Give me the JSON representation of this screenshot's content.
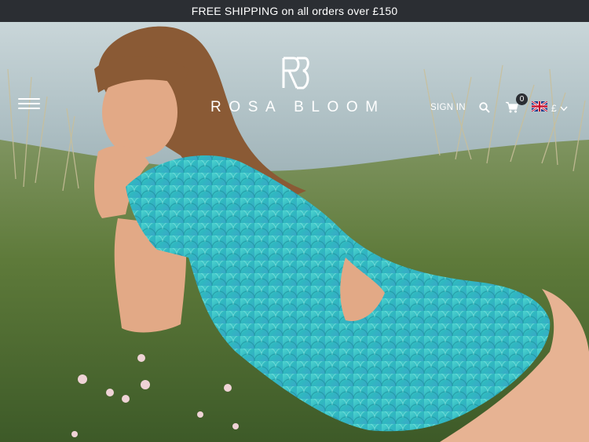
{
  "announcement": {
    "text": "FREE SHIPPING on all orders over £150"
  },
  "header": {
    "brand_name": "ROSA BLOOM",
    "sign_in_label": "SIGN IN",
    "cart_count": "0",
    "currency_symbol": "£",
    "icons": {
      "menu": "hamburger-icon",
      "search": "search-icon",
      "cart": "cart-icon",
      "flag": "uk-flag-icon",
      "chevron": "chevron-down-icon",
      "logo": "rb-monogram-icon"
    }
  },
  "colors": {
    "announcement_bar": "#2b2e33",
    "header_text": "#ffffff",
    "sequin_teal": "#3cc6c4"
  }
}
